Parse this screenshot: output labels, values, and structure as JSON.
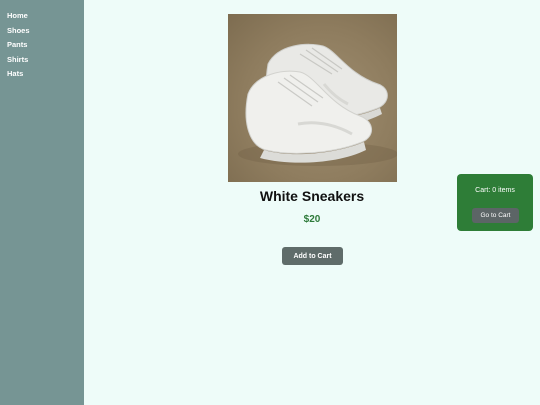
{
  "sidebar": {
    "items": [
      {
        "label": "Home"
      },
      {
        "label": "Shoes"
      },
      {
        "label": "Pants"
      },
      {
        "label": "Shirts"
      },
      {
        "label": "Hats"
      }
    ]
  },
  "product": {
    "title": "White Sneakers",
    "price": "$20",
    "image_icon": "white-sneakers-photo",
    "add_to_cart_label": "Add to Cart"
  },
  "cart": {
    "count_text": "Cart: 0 items",
    "go_to_cart_label": "Go to Cart"
  },
  "colors": {
    "sidebar_bg": "#769594",
    "page_bg": "#eefcf9",
    "price": "#2d7a3a",
    "cart_widget_bg": "#2e7d37",
    "button_bg": "#5f6c6a"
  }
}
